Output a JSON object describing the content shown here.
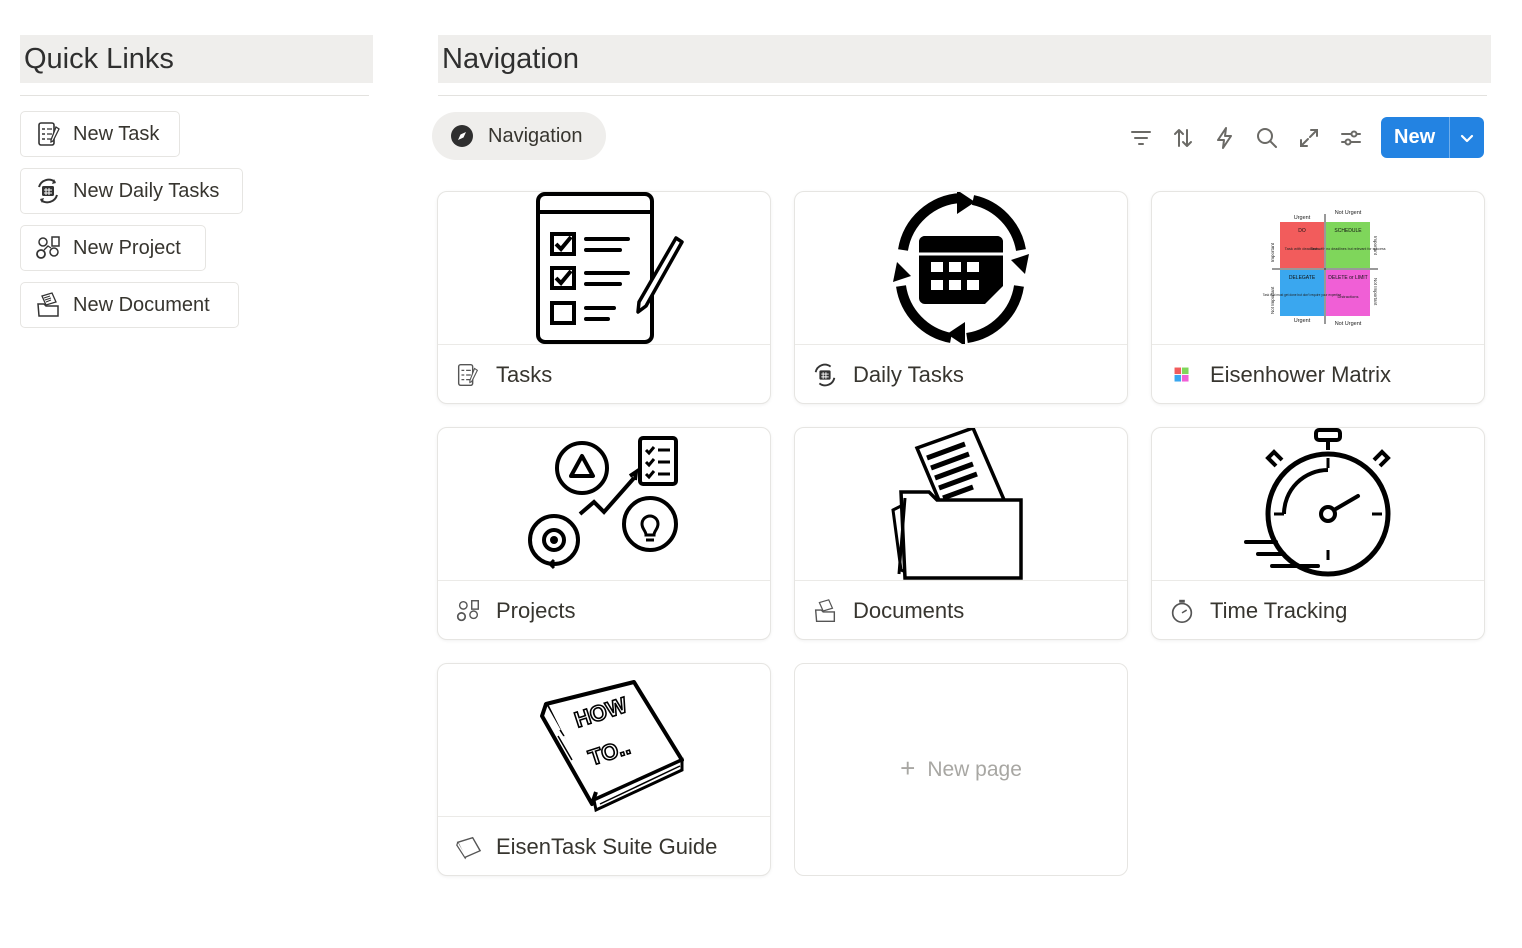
{
  "quick_links": {
    "title": "Quick Links",
    "buttons": [
      {
        "label": "New Task",
        "icon": "task-list-icon"
      },
      {
        "label": "New Daily Tasks",
        "icon": "calendar-cycle-icon"
      },
      {
        "label": "New Project",
        "icon": "project-icon"
      },
      {
        "label": "New Document",
        "icon": "folder-documents-icon"
      }
    ]
  },
  "navigation": {
    "title": "Navigation",
    "view_tab": {
      "label": "Navigation",
      "icon": "compass-icon"
    },
    "toolbar": {
      "icons": [
        "filter-icon",
        "sort-icon",
        "lightning-icon",
        "search-icon",
        "expand-icon",
        "settings-sliders-icon"
      ],
      "new_label": "New"
    },
    "cards": [
      {
        "title": "Tasks",
        "icon": "task-list-icon"
      },
      {
        "title": "Daily Tasks",
        "icon": "calendar-cycle-icon"
      },
      {
        "title": "Eisenhower Matrix",
        "icon": "matrix-icon",
        "matrix": {
          "top_labels": [
            "Urgent",
            "Not Urgent"
          ],
          "bottom_labels": [
            "Urgent",
            "Not Urgent"
          ],
          "side_labels": [
            "Important",
            "Not Important"
          ],
          "quadrants": [
            {
              "title": "DO",
              "text": "Task with deadlines",
              "color": "#f25c5c"
            },
            {
              "title": "SCHEDULE",
              "text": "Task with no deadlines but relevant for success",
              "color": "#7fd65b"
            },
            {
              "title": "DELEGATE",
              "text": "Task that must get done but don't require your expertise",
              "color": "#3aa7ef"
            },
            {
              "title": "DELETE or LIMIT",
              "text": "Distractions",
              "color": "#f05fd6"
            }
          ]
        }
      },
      {
        "title": "Projects",
        "icon": "project-icon"
      },
      {
        "title": "Documents",
        "icon": "folder-documents-icon"
      },
      {
        "title": "Time Tracking",
        "icon": "stopwatch-icon"
      },
      {
        "title": "EisenTask Suite Guide",
        "icon": "how-to-book-icon",
        "cover_text": [
          "HOW",
          "TO.."
        ]
      }
    ],
    "new_page_label": "New page"
  },
  "colors": {
    "accent": "#2383e2",
    "heading_bg": "#efeeec",
    "border": "#e6e5e2"
  }
}
